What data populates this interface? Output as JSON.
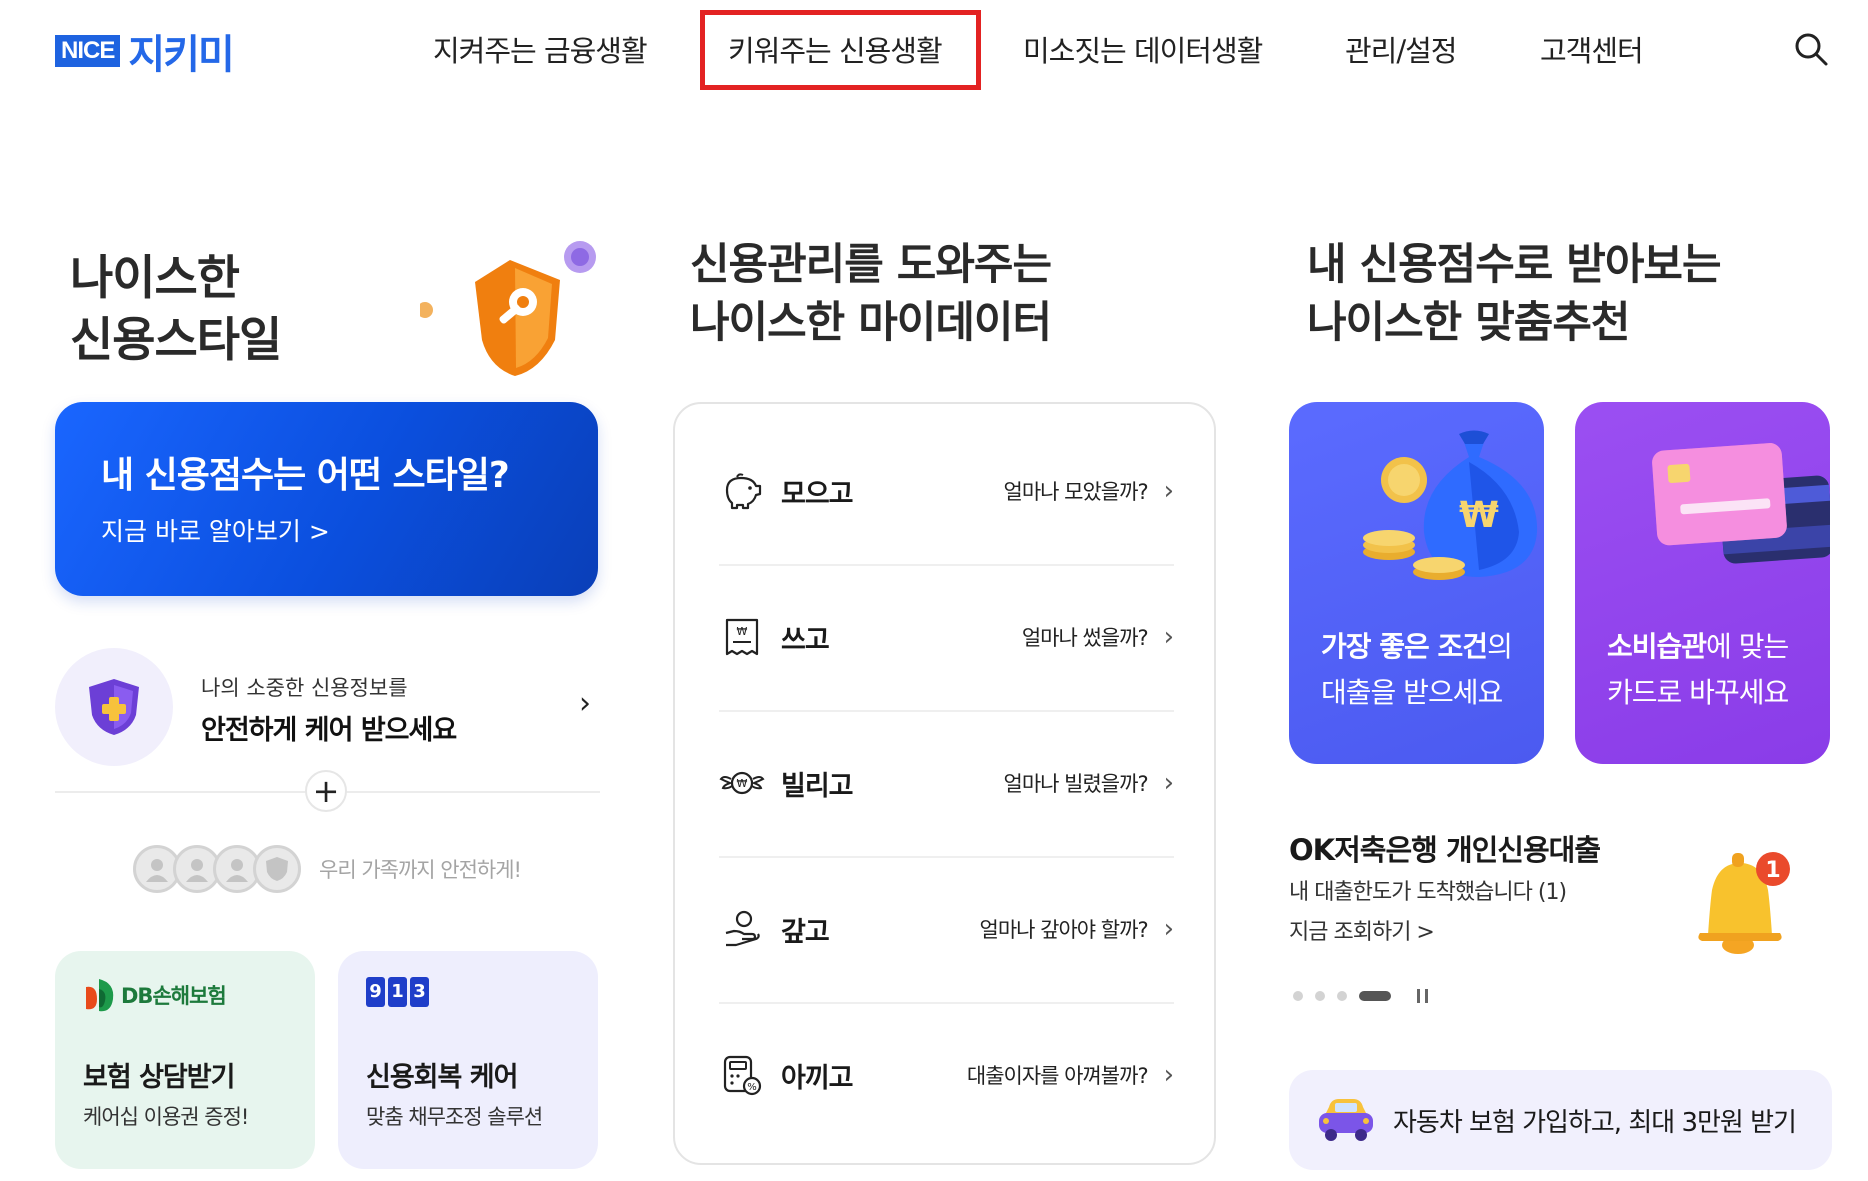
{
  "brand": {
    "nice": "NICE",
    "name": "지키미"
  },
  "nav": {
    "items": [
      "지켜주는 금융생활",
      "키워주는 신용생활",
      "미소짓는 데이터생활",
      "관리/설정",
      "고객센터"
    ],
    "active_index": 1,
    "search_icon": "search-icon"
  },
  "col1": {
    "title": "나이스한\n신용스타일",
    "cta": {
      "title": "내 신용점수는 어떤 스타일?",
      "sub": "지금 바로 알아보기 >"
    },
    "care": {
      "small": "나의 소중한 신용정보를",
      "big": "안전하게 케어 받으세요"
    },
    "plus": "+",
    "family": "우리 가족까지 안전하게!",
    "cards": [
      {
        "brand": "DB손해보험",
        "title": "보험 상담받기",
        "sub": "케어십 이용권 증정!"
      },
      {
        "digits": [
          "9",
          "1",
          "3"
        ],
        "title": "신용회복 케어",
        "sub": "맞춤 채무조정 솔루션"
      }
    ]
  },
  "col2": {
    "title": "신용관리를 도와주는\n나이스한 마이데이터",
    "rows": [
      {
        "label": "모으고",
        "question": "얼마나 모았을까?",
        "icon": "piggy-bank-icon"
      },
      {
        "label": "쓰고",
        "question": "얼마나 썼을까?",
        "icon": "receipt-icon"
      },
      {
        "label": "빌리고",
        "question": "얼마나 빌렸을까?",
        "icon": "winged-coin-icon"
      },
      {
        "label": "갚고",
        "question": "얼마나 갚아야 할까?",
        "icon": "hand-coin-icon"
      },
      {
        "label": "아끼고",
        "question": "대출이자를 아껴볼까?",
        "icon": "calculator-icon"
      }
    ]
  },
  "col3": {
    "title": "내 신용점수로 받아보는\n나이스한 맞춤추천",
    "card1": {
      "bold": "가장 좋은 조건",
      "rest1": "의",
      "line2": "대출을 받으세요"
    },
    "card2": {
      "bold": "소비습관",
      "rest1": "에 맞는",
      "line2": "카드로 바꾸세요"
    },
    "loan": {
      "title": "OK저축은행 개인신용대출",
      "sub": "내 대출한도가 도착했습니다 (1)",
      "link": "지금 조회하기 >",
      "badge": "1"
    },
    "carousel": {
      "count": 4,
      "active": 3
    },
    "banner": "자동차 보험 가입하고, 최대 3만원 받기"
  },
  "colors": {
    "primary": "#1a66ff",
    "highlight": "#e32222",
    "recBlue": "#5b6bff",
    "recViolet": "#9b4ff2"
  }
}
